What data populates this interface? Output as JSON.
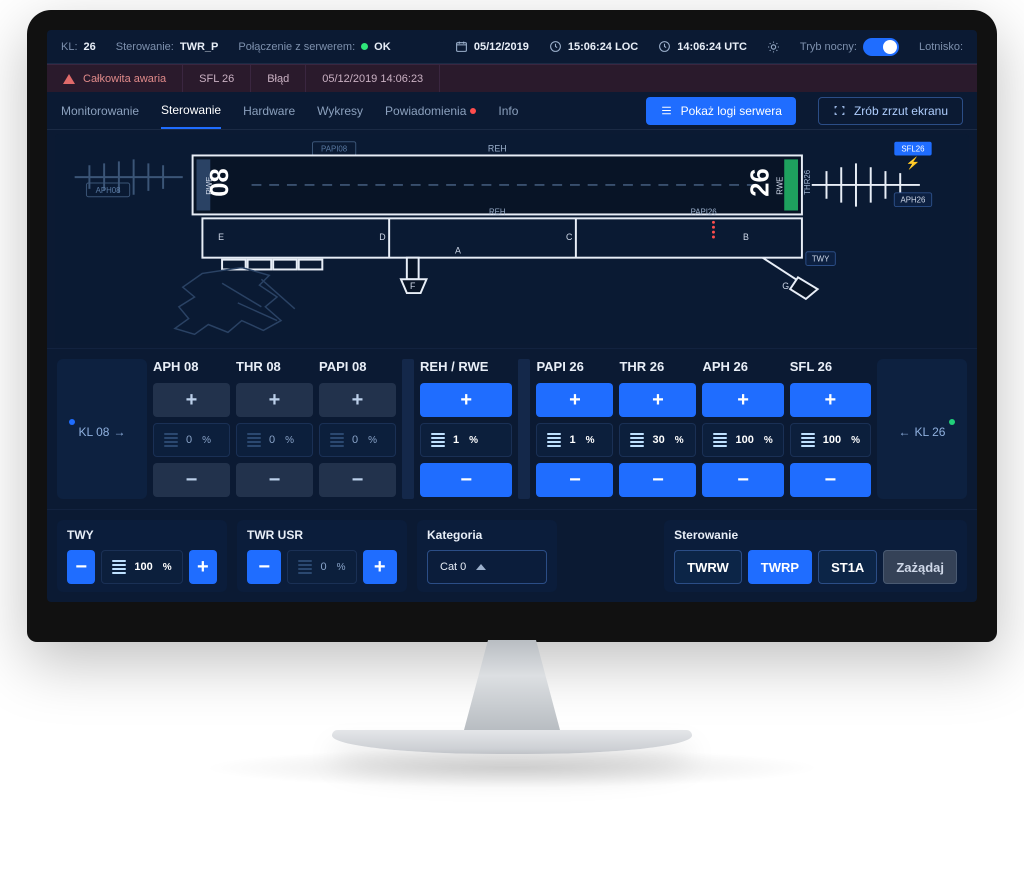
{
  "topbar": {
    "kl_label": "KL:",
    "kl_value": "26",
    "sterowanie_label": "Sterowanie:",
    "sterowanie_value": "TWR_P",
    "conn_label": "Połączenie z serwerem:",
    "conn_value": "OK",
    "date": "05/12/2019",
    "time_loc": "15:06:24 LOC",
    "time_utc": "14:06:24 UTC",
    "night_label": "Tryb nocny:",
    "airport_label": "Lotnisko:"
  },
  "alert": {
    "msg": "Całkowita awaria",
    "code": "SFL 26",
    "status": "Błąd",
    "ts": "05/12/2019  14:06:23"
  },
  "tabs": {
    "items": [
      "Monitorowanie",
      "Sterowanie",
      "Hardware",
      "Wykresy",
      "Powiadomienia",
      "Info"
    ],
    "active": 1,
    "has_dot_index": 4,
    "btn_logs": "Pokaż logi serwera",
    "btn_shot": "Zrób zrzut ekranu"
  },
  "map": {
    "labels": {
      "reh_top": "REH",
      "reh_mid": "REH",
      "papi26": "PAPI26",
      "rwy_left_num": "08",
      "rwy_right_num": "26",
      "rwe": "RWE",
      "thr26": "THR26",
      "aph08": "APH08",
      "papi08": "PAPI08",
      "twy": "TWY",
      "a": "A",
      "b": "B",
      "c": "C",
      "d": "D",
      "e": "E",
      "f": "F",
      "g": "G",
      "sfl26": "SFL26",
      "aph26": "APH26"
    }
  },
  "side": {
    "left": "KL 08",
    "right": "KL 26"
  },
  "cols": {
    "aph08": {
      "title": "APH 08",
      "val": "0",
      "active": false
    },
    "thr08": {
      "title": "THR 08",
      "val": "0",
      "active": false
    },
    "papi08": {
      "title": "PAPI 08",
      "val": "0",
      "active": false
    },
    "rehrwe": {
      "title": "REH / RWE",
      "val": "1",
      "active": true
    },
    "papi26": {
      "title": "PAPI 26",
      "val": "1",
      "active": true
    },
    "thr26": {
      "title": "THR 26",
      "val": "30",
      "active": true
    },
    "aph26": {
      "title": "APH 26",
      "val": "100",
      "active": true
    },
    "sfl26": {
      "title": "SFL 26",
      "val": "100",
      "active": true
    }
  },
  "bottom": {
    "twy": {
      "label": "TWY",
      "val": "100"
    },
    "twrusr": {
      "label": "TWR USR",
      "val": "0"
    },
    "kat_label": "Kategoria",
    "kat_val": "Cat 0",
    "ster_label": "Sterowanie",
    "chips": {
      "twrw": "TWRW",
      "twrp": "TWRP",
      "st1a": "ST1A",
      "req": "Zażądaj"
    }
  },
  "pct": "%"
}
